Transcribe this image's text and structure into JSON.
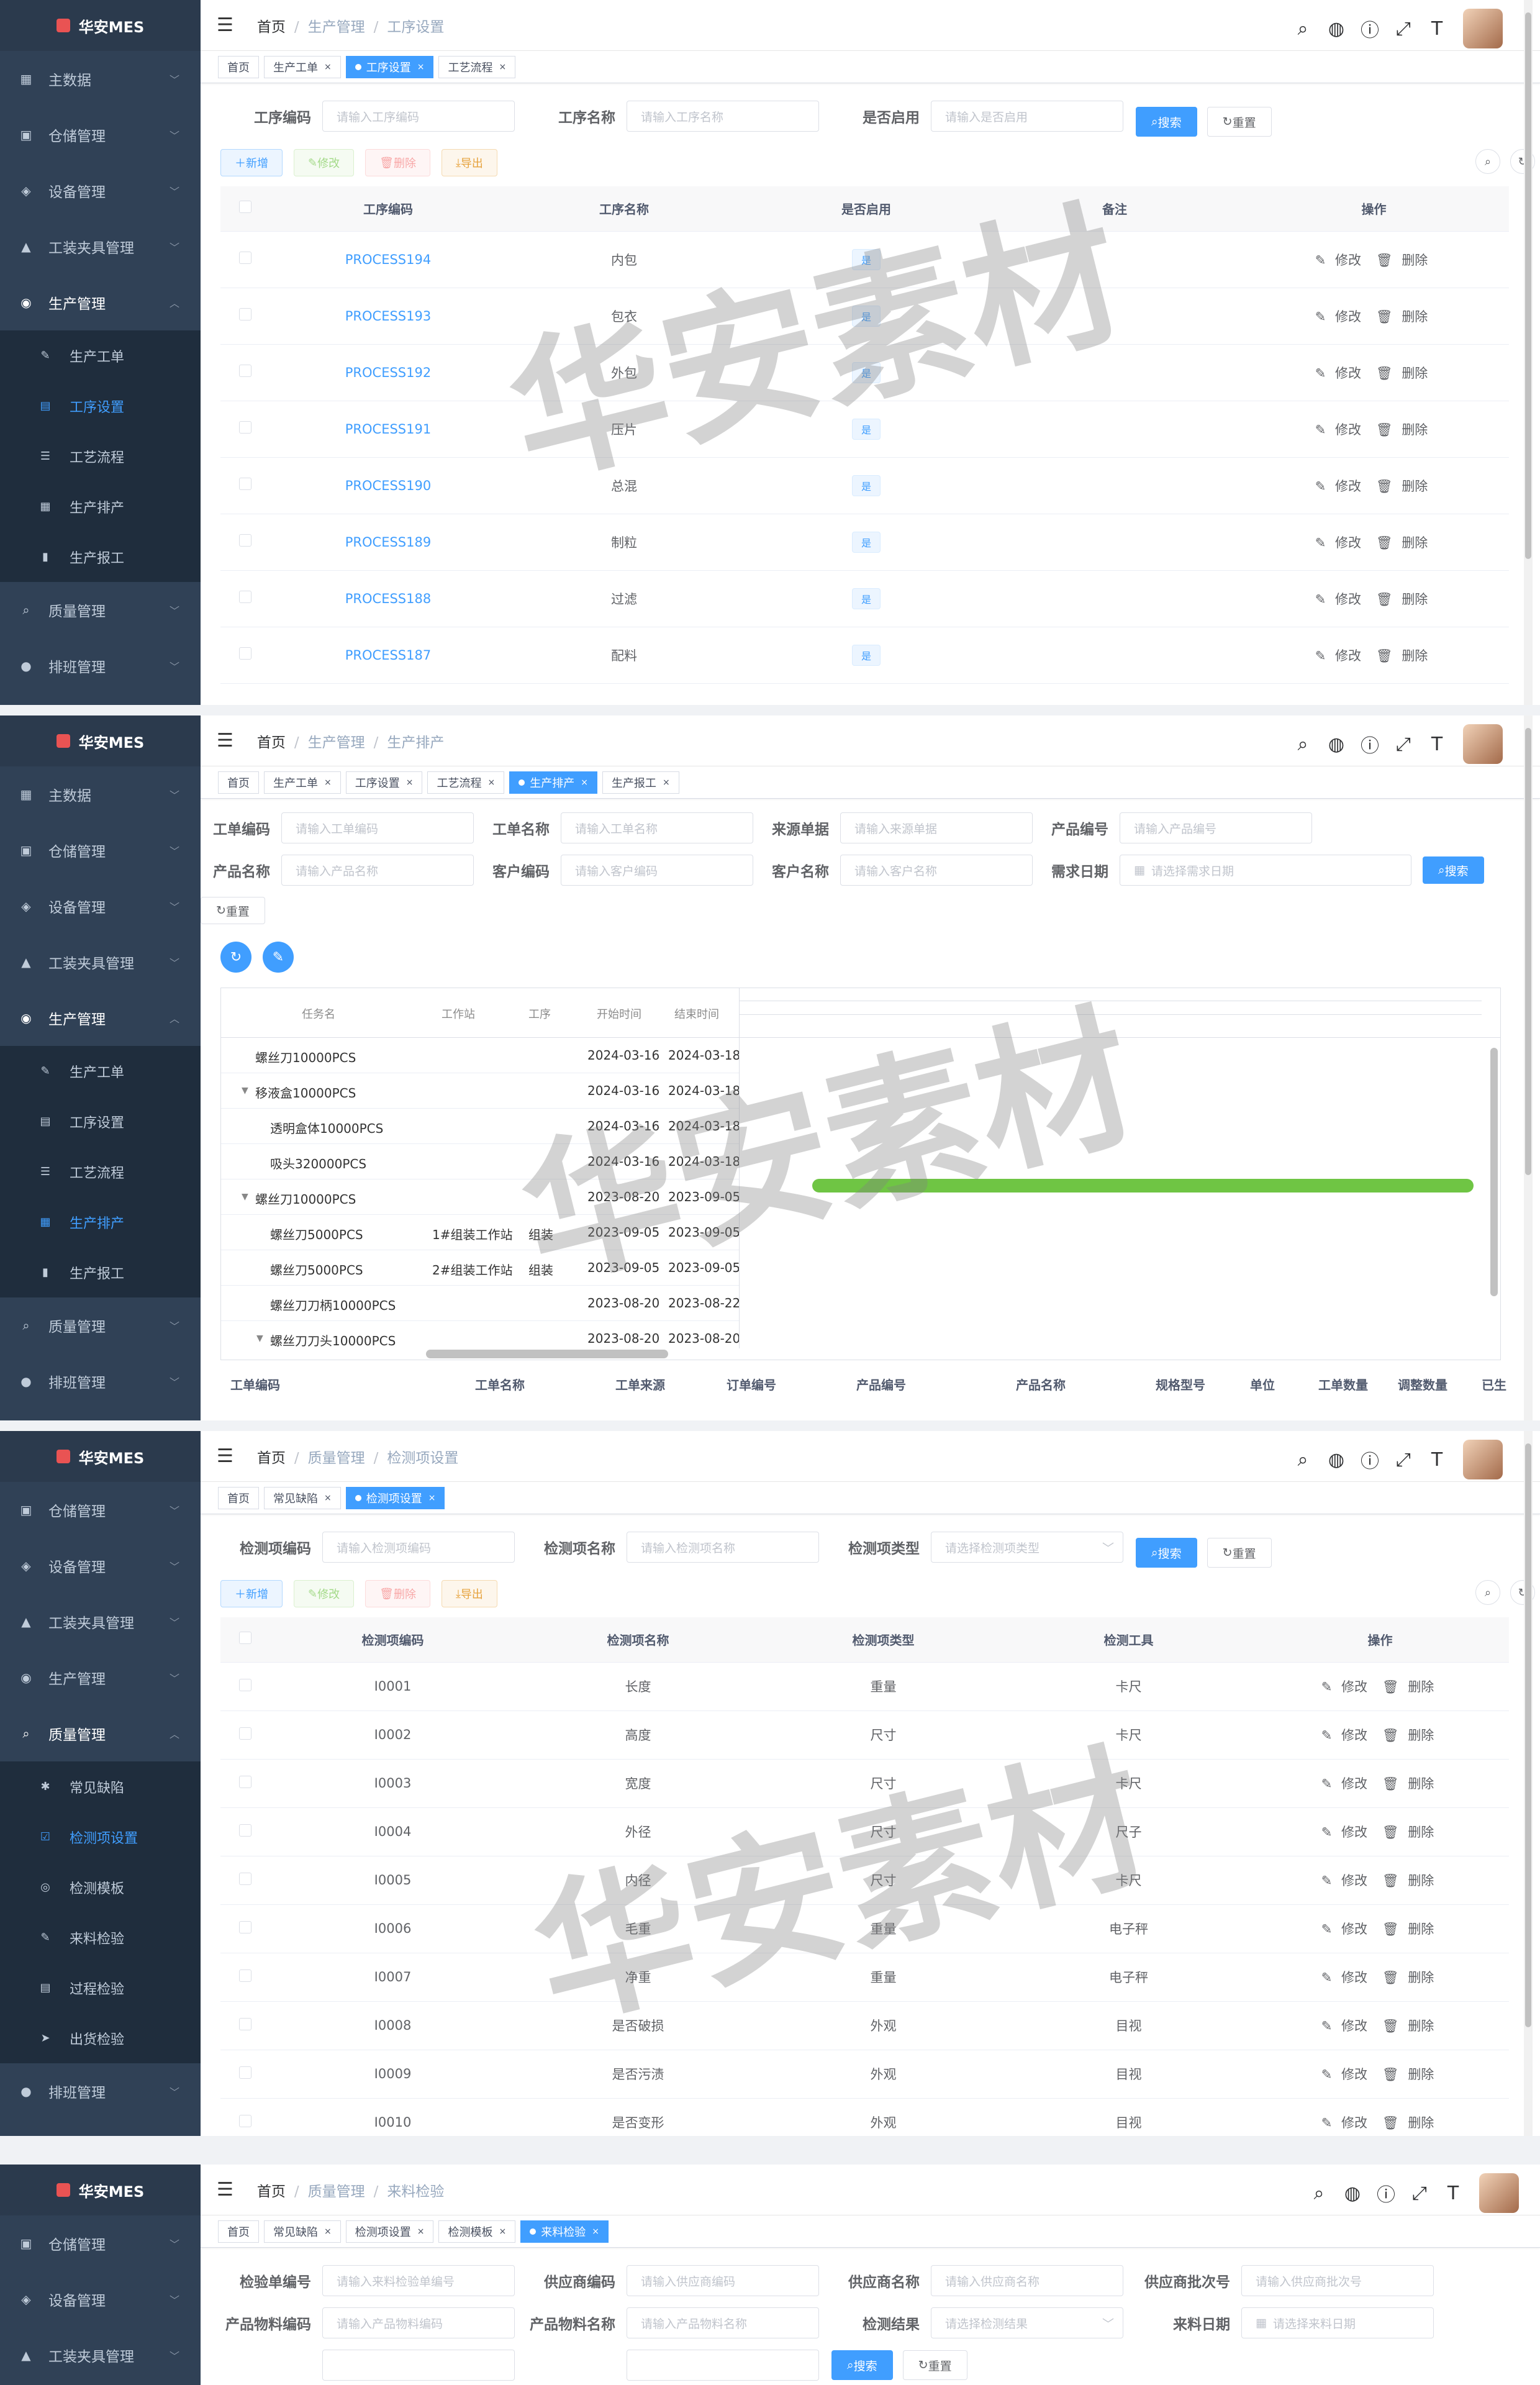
{
  "brand": {
    "name": "华安MES"
  },
  "watermark": "华安素材",
  "common": {
    "home": "首页",
    "search_btn": "搜索",
    "reset_btn": "重置",
    "add_btn": "新增",
    "edit_btn": "修改",
    "delete_btn": "删除",
    "export_btn": "导出",
    "op_edit": "修改",
    "op_delete": "删除"
  },
  "menu": {
    "master_data": "主数据",
    "warehouse": "仓储管理",
    "equipment": "设备管理",
    "fixture": "工装夹具管理",
    "production": "生产管理",
    "quality": "质量管理",
    "shift": "排班管理",
    "prod_sub": [
      "生产工单",
      "工序设置",
      "工艺流程",
      "生产排产",
      "生产报工"
    ],
    "quality_sub": [
      "常见缺陷",
      "检测项设置",
      "检测模板",
      "来料检验",
      "过程检验",
      "出货检验"
    ]
  },
  "s1": {
    "crumb": [
      "首页",
      "生产管理",
      "工序设置"
    ],
    "tags": [
      "首页",
      "生产工单",
      "工序设置",
      "工艺流程"
    ],
    "labels": [
      "工序编码",
      "工序名称",
      "是否启用"
    ],
    "placeholders": [
      "请输入工序编码",
      "请输入工序名称",
      "请输入是否启用"
    ],
    "headers": [
      "工序编码",
      "工序名称",
      "是否启用",
      "备注",
      "操作"
    ],
    "rows": [
      {
        "code": "PROCESS194",
        "name": "内包",
        "enabled": "是"
      },
      {
        "code": "PROCESS193",
        "name": "包衣",
        "enabled": "是"
      },
      {
        "code": "PROCESS192",
        "name": "外包",
        "enabled": "是"
      },
      {
        "code": "PROCESS191",
        "name": "压片",
        "enabled": "是"
      },
      {
        "code": "PROCESS190",
        "name": "总混",
        "enabled": "是"
      },
      {
        "code": "PROCESS189",
        "name": "制粒",
        "enabled": "是"
      },
      {
        "code": "PROCESS188",
        "name": "过滤",
        "enabled": "是"
      },
      {
        "code": "PROCESS187",
        "name": "配料",
        "enabled": "是"
      }
    ]
  },
  "s2": {
    "crumb": [
      "首页",
      "生产管理",
      "生产排产"
    ],
    "tags": [
      "首页",
      "生产工单",
      "工序设置",
      "工艺流程",
      "生产排产",
      "生产报工"
    ],
    "labels": [
      "工单编码",
      "工单名称",
      "来源单据",
      "产品编号",
      "产品名称",
      "客户编码",
      "客户名称",
      "需求日期"
    ],
    "placeholders": [
      "请输入工单编码",
      "请输入工单名称",
      "请输入来源单据",
      "请输入产品编号",
      "请输入产品名称",
      "请输入客户编码",
      "请输入客户名称",
      "请选择需求日期"
    ],
    "gantt_headers": [
      "任务名",
      "工作站",
      "工序",
      "开始时间",
      "结束时间"
    ],
    "gantt_rows": [
      {
        "task": "螺丝刀10000PCS",
        "station": "",
        "process": "",
        "start": "2024-03-16",
        "end": "2024-03-18"
      },
      {
        "task": "移液盒10000PCS",
        "station": "",
        "process": "",
        "start": "2024-03-16",
        "end": "2024-03-18"
      },
      {
        "task": "透明盒体10000PCS",
        "station": "",
        "process": "",
        "start": "2024-03-16",
        "end": "2024-03-18"
      },
      {
        "task": "吸头320000PCS",
        "station": "",
        "process": "",
        "start": "2024-03-16",
        "end": "2024-03-18"
      },
      {
        "task": "螺丝刀10000PCS",
        "station": "",
        "process": "",
        "start": "2023-08-20",
        "end": "2023-09-05"
      },
      {
        "task": "螺丝刀5000PCS",
        "station": "1#组装工作站",
        "process": "组装",
        "start": "2023-09-05",
        "end": "2023-09-05"
      },
      {
        "task": "螺丝刀5000PCS",
        "station": "2#组装工作站",
        "process": "组装",
        "start": "2023-09-05",
        "end": "2023-09-05"
      },
      {
        "task": "螺丝刀刀柄10000PCS",
        "station": "",
        "process": "",
        "start": "2023-08-20",
        "end": "2023-08-22"
      },
      {
        "task": "螺丝刀刀头10000PCS",
        "station": "",
        "process": "",
        "start": "2023-08-20",
        "end": "2023-08-20"
      }
    ],
    "table_headers": [
      "工单编码",
      "工单名称",
      "工单来源",
      "订单编号",
      "产品编号",
      "产品名称",
      "规格型号",
      "单位",
      "工单数量",
      "调整数量",
      "已生"
    ]
  },
  "s3": {
    "crumb": [
      "首页",
      "质量管理",
      "检测项设置"
    ],
    "tags": [
      "首页",
      "常见缺陷",
      "检测项设置"
    ],
    "labels": [
      "检测项编码",
      "检测项名称",
      "检测项类型"
    ],
    "placeholders": [
      "请输入检测项编码",
      "请输入检测项名称",
      "请选择检测项类型"
    ],
    "headers": [
      "检测项编码",
      "检测项名称",
      "检测项类型",
      "检测工具",
      "操作"
    ],
    "rows": [
      {
        "code": "I0001",
        "name": "长度",
        "type": "重量",
        "tool": "卡尺"
      },
      {
        "code": "I0002",
        "name": "高度",
        "type": "尺寸",
        "tool": "卡尺"
      },
      {
        "code": "I0003",
        "name": "宽度",
        "type": "尺寸",
        "tool": "卡尺"
      },
      {
        "code": "I0004",
        "name": "外径",
        "type": "尺寸",
        "tool": "尺子"
      },
      {
        "code": "I0005",
        "name": "内径",
        "type": "尺寸",
        "tool": "卡尺"
      },
      {
        "code": "I0006",
        "name": "毛重",
        "type": "重量",
        "tool": "电子秤"
      },
      {
        "code": "I0007",
        "name": "净重",
        "type": "重量",
        "tool": "电子秤"
      },
      {
        "code": "I0008",
        "name": "是否破损",
        "type": "外观",
        "tool": "目视"
      },
      {
        "code": "I0009",
        "name": "是否污渍",
        "type": "外观",
        "tool": "目视"
      },
      {
        "code": "I0010",
        "name": "是否变形",
        "type": "外观",
        "tool": "目视"
      }
    ]
  },
  "s4": {
    "crumb": [
      "首页",
      "质量管理",
      "来料检验"
    ],
    "tags": [
      "首页",
      "常见缺陷",
      "检测项设置",
      "检测模板",
      "来料检验"
    ],
    "labels": [
      "检验单编号",
      "供应商编码",
      "供应商名称",
      "供应商批次号",
      "产品物料编码",
      "产品物料名称",
      "检测结果",
      "来料日期"
    ],
    "placeholders": [
      "请输入来料检验单编号",
      "请输入供应商编码",
      "请输入供应商名称",
      "请输入供应商批次号",
      "请输入产品物料编码",
      "请输入产品物料名称",
      "请选择检测结果",
      "请选择来料日期"
    ]
  }
}
